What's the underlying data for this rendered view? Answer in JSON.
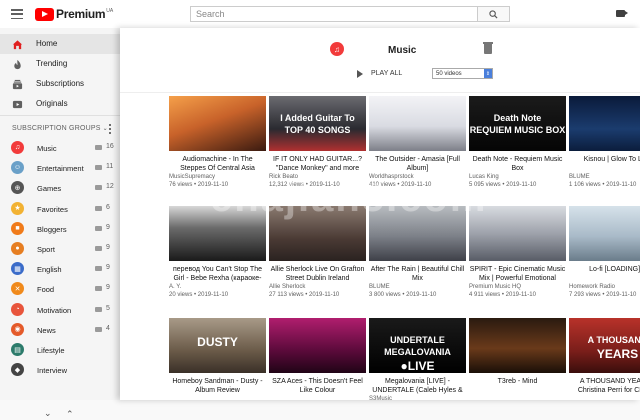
{
  "header": {
    "brand": "Premium",
    "brand_super": "UA",
    "search_placeholder": "Search"
  },
  "nav": [
    {
      "label": "Home",
      "icon": "home-icon",
      "active": true
    },
    {
      "label": "Trending",
      "icon": "flame-icon"
    },
    {
      "label": "Subscriptions",
      "icon": "subscriptions-icon"
    },
    {
      "label": "Originals",
      "icon": "originals-icon"
    }
  ],
  "subscription_groups": {
    "heading": "SUBSCRIPTION GROUPS",
    "items": [
      {
        "label": "Music",
        "count": "16",
        "color": "#f23b3b",
        "glyph": "♫"
      },
      {
        "label": "Entertainment",
        "count": "11",
        "color": "#6aa0c8",
        "glyph": "☺"
      },
      {
        "label": "Games",
        "count": "12",
        "color": "#555555",
        "glyph": "⊕"
      },
      {
        "label": "Favorites",
        "count": "6",
        "color": "#f2b233",
        "glyph": "★"
      },
      {
        "label": "Bloggers",
        "count": "9",
        "color": "#f07b1a",
        "glyph": "■"
      },
      {
        "label": "Sport",
        "count": "9",
        "color": "#e67e22",
        "glyph": "●"
      },
      {
        "label": "English",
        "count": "9",
        "color": "#3b6cc9",
        "glyph": "▦"
      },
      {
        "label": "Food",
        "count": "9",
        "color": "#f08a1c",
        "glyph": "✕"
      },
      {
        "label": "Motivation",
        "count": "5",
        "color": "#e8553c",
        "glyph": "◔"
      },
      {
        "label": "News",
        "count": "4",
        "color": "#e45a2a",
        "glyph": "◉"
      },
      {
        "label": "Lifestyle",
        "count": "",
        "color": "#2c7b6b",
        "glyph": "▤"
      },
      {
        "label": "Interview",
        "count": "",
        "color": "#444444",
        "glyph": "◆"
      }
    ]
  },
  "panel": {
    "title": "Music",
    "play_all": "PLAY ALL",
    "count_option": "50 videos"
  },
  "watermark": "chajian5.com",
  "videos": [
    {
      "title": "Audiomachine - In The Steppes Of Central Asia",
      "channel": "MusicSupremacy",
      "meta": "76 views • 2019-11-10",
      "bg": "linear-gradient(160deg,#f5a04a 0%,#c8622a 45%,#3a1a10 100%)",
      "overlay": ""
    },
    {
      "title": "IF IT ONLY HAD GUITAR...? \"Dance Monkey\" and more",
      "channel": "Rick Beato",
      "meta": "12,312 views • 2019-11-10",
      "bg": "linear-gradient(180deg,#6b6b70 0%,#2a2a30 60%,#b03030 100%)",
      "overlay": "I Added Guitar To|TOP 40 SONGS"
    },
    {
      "title": "The Outsider - Amasia [Full Album]",
      "channel": "Worldhasprstock",
      "meta": "410 views • 2019-11-10",
      "bg": "linear-gradient(180deg,#f3f3f6 0%,#d9dbe2 55%,#7d7f88 100%)",
      "overlay": ""
    },
    {
      "title": "Death Note - Requiem Music Box",
      "channel": "Lucas King",
      "meta": "5 095 views • 2019-11-10",
      "bg": "linear-gradient(180deg,#1b1b1b 0%,#050505 100%)",
      "overlay": "Death Note|REQUIEM MUSIC BOX"
    },
    {
      "title": "Kisnou | Glow To Last",
      "channel": "BLUME",
      "meta": "1 106 views • 2019-11-10",
      "bg": "linear-gradient(180deg,#0a1a3a 0%,#1b3c6e 60%,#0b1d3c 100%)",
      "overlay": ""
    },
    {
      "title": "перевод You Can't Stop The Girl - Bebe Rexha (караоке-",
      "channel": "A. Y.",
      "meta": "20 views • 2019-11-10",
      "bg": "linear-gradient(180deg,#d8d8d8 0%,#6a6a6a 40%,#1a1a1a 100%)",
      "overlay": ""
    },
    {
      "title": "Allie Sherlock Live On Grafton Street Dublin Ireland",
      "channel": "Allie Sherlock",
      "meta": "27 113 views • 2019-11-10",
      "bg": "linear-gradient(180deg,#8a7a70 0%,#4a3a34 60%,#2a2220 100%)",
      "overlay": ""
    },
    {
      "title": "After The Rain | Beautiful Chill Mix",
      "channel": "BLUME",
      "meta": "3 800 views • 2019-11-10",
      "bg": "linear-gradient(180deg,#b8bcc0 0%,#7c8088 55%,#3e4048 100%)",
      "overlay": ""
    },
    {
      "title": "SPIRIT - Epic Cinematic Music Mix | Powerful Emotional",
      "channel": "Premium Music HQ",
      "meta": "4 911 views • 2019-11-10",
      "bg": "linear-gradient(180deg,#d8dbe0 0%,#9ea2ab 50%,#585c66 100%)",
      "overlay": ""
    },
    {
      "title": "Lo-fi [LOADING]...",
      "channel": "Homework Radio",
      "meta": "7 293 views • 2019-11-10",
      "bg": "linear-gradient(180deg,#d6e2ea 0%,#a9bac8 55%,#6a7c8a 100%)",
      "overlay": ""
    },
    {
      "title": "Homeboy Sandman - Dusty - Album Review",
      "channel": "",
      "meta": "",
      "bg": "linear-gradient(180deg,#a89a88 0%,#6a5a48 60%,#3a3028 100%)",
      "overlay": "DUSTY"
    },
    {
      "title": "SZA Aces - This Doesn't Feel Like Colour",
      "channel": "",
      "meta": "",
      "bg": "linear-gradient(180deg,#b01e6e 0%,#5a0a3a 60%,#200416 100%)",
      "overlay": ""
    },
    {
      "title": "Megalovania [LIVE] - UNDERTALE (Caleb Hyles &",
      "channel": "S3Music",
      "meta": "",
      "bg": "linear-gradient(180deg,#1a1a1a 0%,#000000 100%)",
      "overlay": "UNDERTALE|MEGALOVANIA|●LIVE"
    },
    {
      "title": "T3reb - Mind",
      "channel": "",
      "meta": "",
      "bg": "linear-gradient(180deg,#2a1a10 0%,#6a3a1a 55%,#1a0f08 100%)",
      "overlay": ""
    },
    {
      "title": "A THOUSAND YEARS - Christina Perri for CELLO",
      "channel": "",
      "meta": "",
      "bg": "linear-gradient(180deg,#b8322a 0%,#7a1e1a 60%,#3a0e0c 100%)",
      "overlay": "A THOUSAND|YEARS"
    }
  ]
}
